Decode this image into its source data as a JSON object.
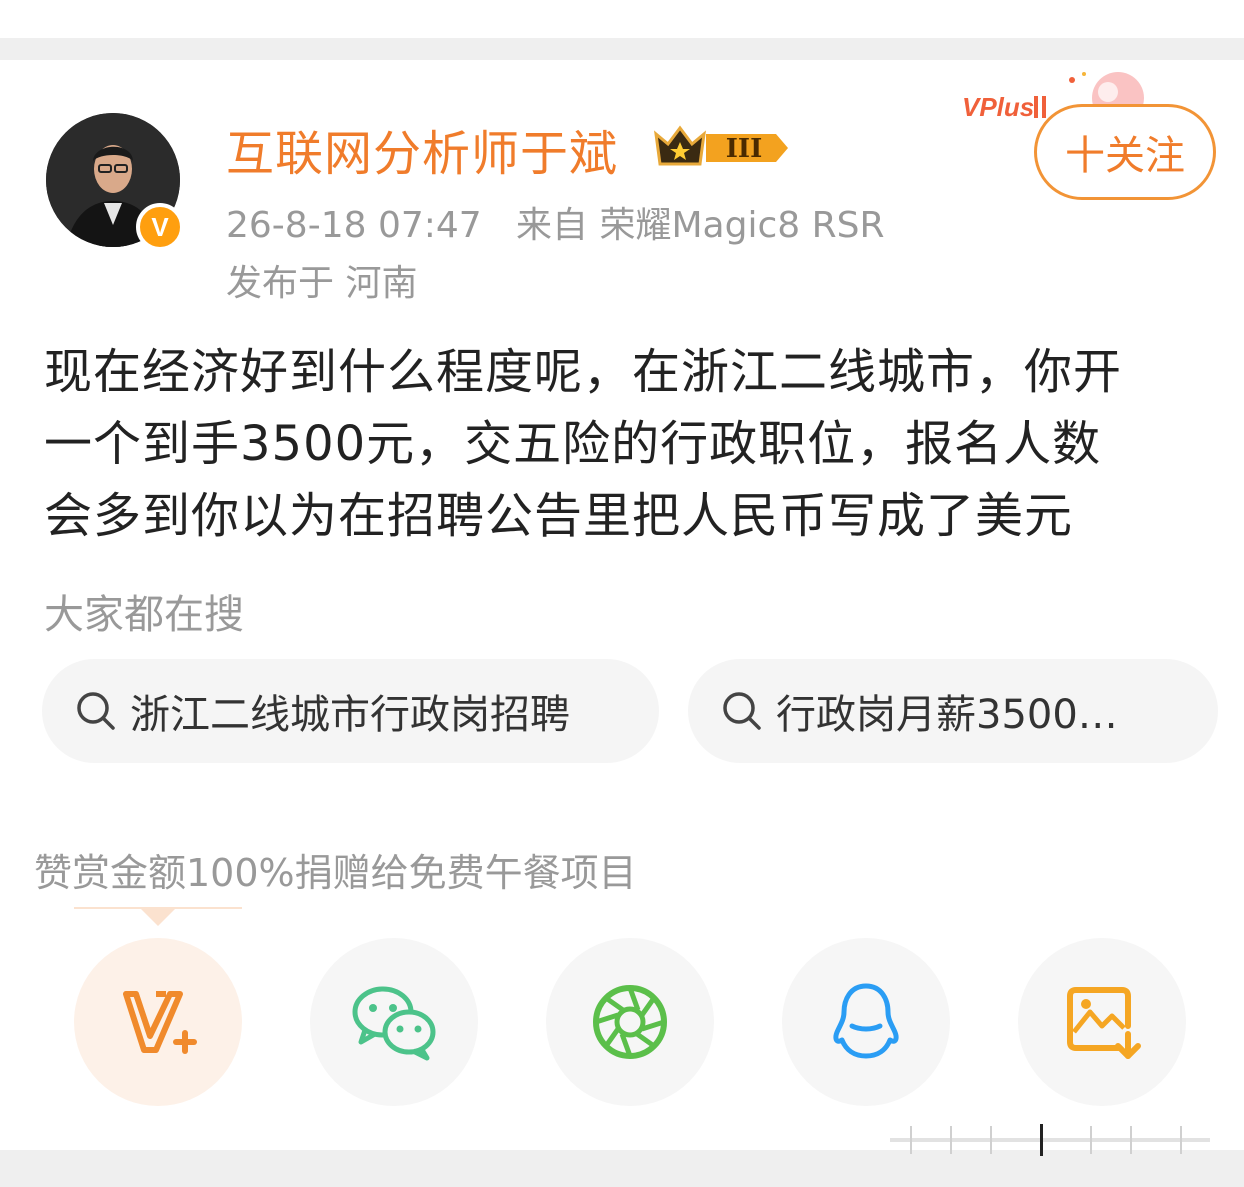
{
  "user": {
    "name": "互联网分析师于斌",
    "level_badge": "III",
    "verified_mark": "V",
    "timestamp": "26-8-18 07:47",
    "source": "来自 荣耀Magic8 RSR",
    "location": "发布于 河南"
  },
  "promo": {
    "vplus_label": "VPlus"
  },
  "follow_button": {
    "label": "十关注"
  },
  "post": {
    "lines": [
      "现在经济好到什么程度呢，在浙江二线城市，你开",
      "一个到手3500元，交五险的行政职位，报名人数",
      "会多到你以为在招聘公告里把人民币写成了美元"
    ]
  },
  "search": {
    "heading": "大家都在搜",
    "items": [
      {
        "label": "浙江二线城市行政岗招聘",
        "icon": "search-icon"
      },
      {
        "label": "行政岗月薪3500…",
        "icon": "search-icon"
      }
    ]
  },
  "donation_note": "赞赏金额100%捐赠给免费午餐项目",
  "share": [
    {
      "name": "vplus-reward",
      "icon": "vplus-icon",
      "color": "#f08a2c"
    },
    {
      "name": "wechat",
      "icon": "wechat-icon",
      "color": "#4cc38a"
    },
    {
      "name": "moments",
      "icon": "moments-icon",
      "color": "#5bbf4a"
    },
    {
      "name": "qq",
      "icon": "qq-icon",
      "color": "#2a9df4"
    },
    {
      "name": "save-image",
      "icon": "save-image-icon",
      "color": "#f5a623"
    }
  ]
}
